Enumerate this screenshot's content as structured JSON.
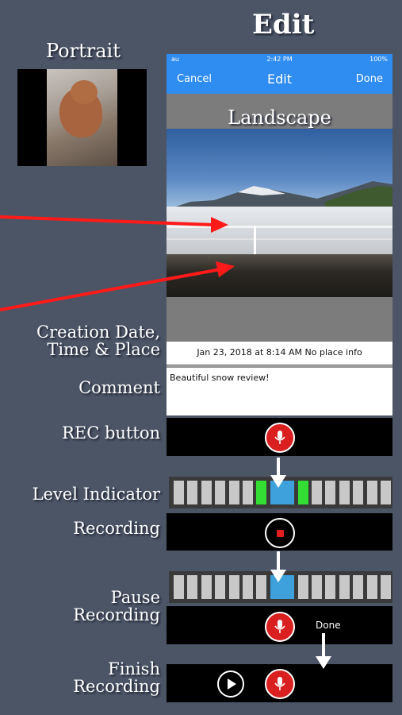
{
  "titles": {
    "edit": "Edit",
    "portrait": "Portrait",
    "landscape": "Landscape"
  },
  "status_bar": {
    "carrier": "au",
    "time": "2:42 PM",
    "battery": "100%"
  },
  "nav": {
    "cancel": "Cancel",
    "title": "Edit",
    "done": "Done"
  },
  "photo_info": {
    "date_place": "Jan 23, 2018 at 8:14 AM No place info",
    "comment": "Beautiful snow review!"
  },
  "labels": {
    "creation_line1": "Creation Date,",
    "creation_line2": "Time & Place",
    "comment": "Comment",
    "rec_button": "REC button",
    "level_indicator": "Level Indicator",
    "recording": "Recording",
    "pause_line1": "Pause",
    "pause_line2": "Recording",
    "finish_line1": "Finish",
    "finish_line2": "Recording",
    "done": "Done"
  },
  "colors": {
    "accent": "#2f8cf0",
    "record": "#d91f1f",
    "level_active": "#33dd33",
    "level_center": "#3fa1dc",
    "arrow": "#ff1a1a"
  },
  "level_indicator_1": [
    "gray",
    "gray",
    "gray",
    "gray",
    "gray",
    "gray",
    "green",
    "blue",
    "blue",
    "green",
    "gray",
    "gray",
    "gray",
    "gray",
    "gray",
    "gray"
  ],
  "level_indicator_2": [
    "gray",
    "gray",
    "gray",
    "gray",
    "gray",
    "gray",
    "gray",
    "blue",
    "blue",
    "gray",
    "gray",
    "gray",
    "gray",
    "gray",
    "gray",
    "gray"
  ],
  "icons": [
    "mic-icon",
    "stop-icon",
    "play-icon",
    "down-arrow-icon",
    "red-arrow-icon"
  ]
}
